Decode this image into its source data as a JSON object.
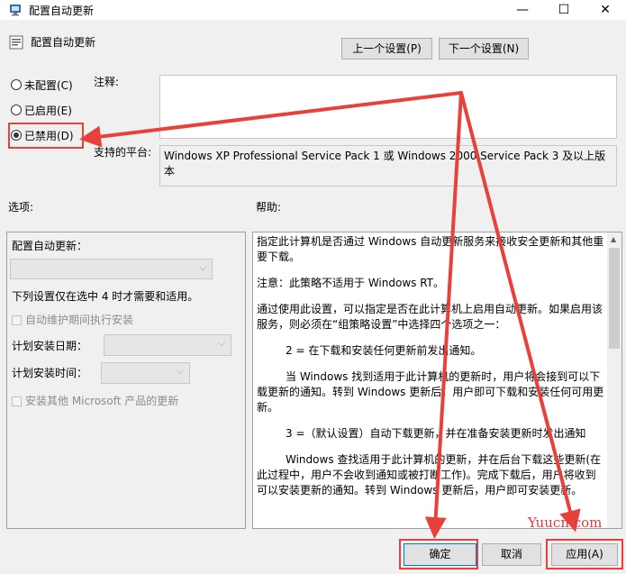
{
  "window": {
    "title": "配置自动更新",
    "minimize_glyph": "—",
    "maximize_glyph": "☐",
    "close_glyph": "✕"
  },
  "header": {
    "policy_name": "配置自动更新",
    "prev_button": "上一个设置(P)",
    "next_button": "下一个设置(N)"
  },
  "state": {
    "options": [
      {
        "label": "未配置(C)",
        "selected": false
      },
      {
        "label": "已启用(E)",
        "selected": false
      },
      {
        "label": "已禁用(D)",
        "selected": true
      }
    ]
  },
  "comment": {
    "label": "注释:",
    "value": ""
  },
  "supported": {
    "label": "支持的平台:",
    "value": "Windows XP Professional Service Pack 1 或 Windows 2000 Service Pack 3 及以上版本"
  },
  "options_panel": {
    "label": "选项:",
    "configure_label": "配置自动更新：",
    "note": "下列设置仅在选中 4 时才需要和适用。",
    "maintenance_checkbox": "自动维护期间执行安装",
    "install_day_label": "计划安装日期：",
    "install_time_label": "计划安装时间：",
    "other_products_checkbox": "安装其他 Microsoft 产品的更新"
  },
  "help_panel": {
    "label": "帮助:",
    "paragraphs": [
      "指定此计算机是否通过 Windows 自动更新服务来接收安全更新和其他重要下载。",
      "注意：此策略不适用于 Windows RT。",
      "通过使用此设置，可以指定是否在此计算机上启用自动更新。如果启用该服务，则必须在“组策略设置”中选择四个选项之一：",
      "2 = 在下载和安装任何更新前发出通知。",
      "当 Windows 找到适用于此计算机的更新时，用户将会接到可以下载更新的通知。转到 Windows 更新后，用户即可下载和安装任何可用更新。",
      "3 =（默认设置）自动下载更新，并在准备安装更新时发出通知",
      "Windows 查找适用于此计算机的更新，并在后台下载这些更新(在此过程中，用户不会收到通知或被打断工作)。完成下载后，用户将收到可以安装更新的通知。转到 Windows 更新后，用户即可安装更新。"
    ]
  },
  "footer": {
    "ok_button": "确定",
    "cancel_button": "取消",
    "apply_button": "应用(A)"
  },
  "watermark": "Yuucn.com",
  "colors": {
    "annotation_red": "#e8413b",
    "watermark": "#e03c3c"
  }
}
